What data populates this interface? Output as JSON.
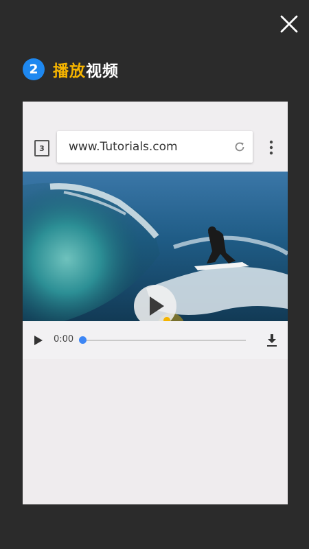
{
  "header": {
    "step_number": "2",
    "title_highlight": "播放",
    "title_rest": "视频"
  },
  "browser": {
    "tab_count": "3",
    "url": "www.Tutorials.com"
  },
  "player": {
    "time": "0:00",
    "progress": 0
  },
  "colors": {
    "background": "#2b2b2b",
    "badge": "#1e88f0",
    "highlight": "#f5b400",
    "seek_thumb": "#3d86f5"
  },
  "icons": [
    "close-icon",
    "reload-icon",
    "more-vert-icon",
    "play-icon",
    "hand-pointer-icon",
    "download-icon"
  ]
}
